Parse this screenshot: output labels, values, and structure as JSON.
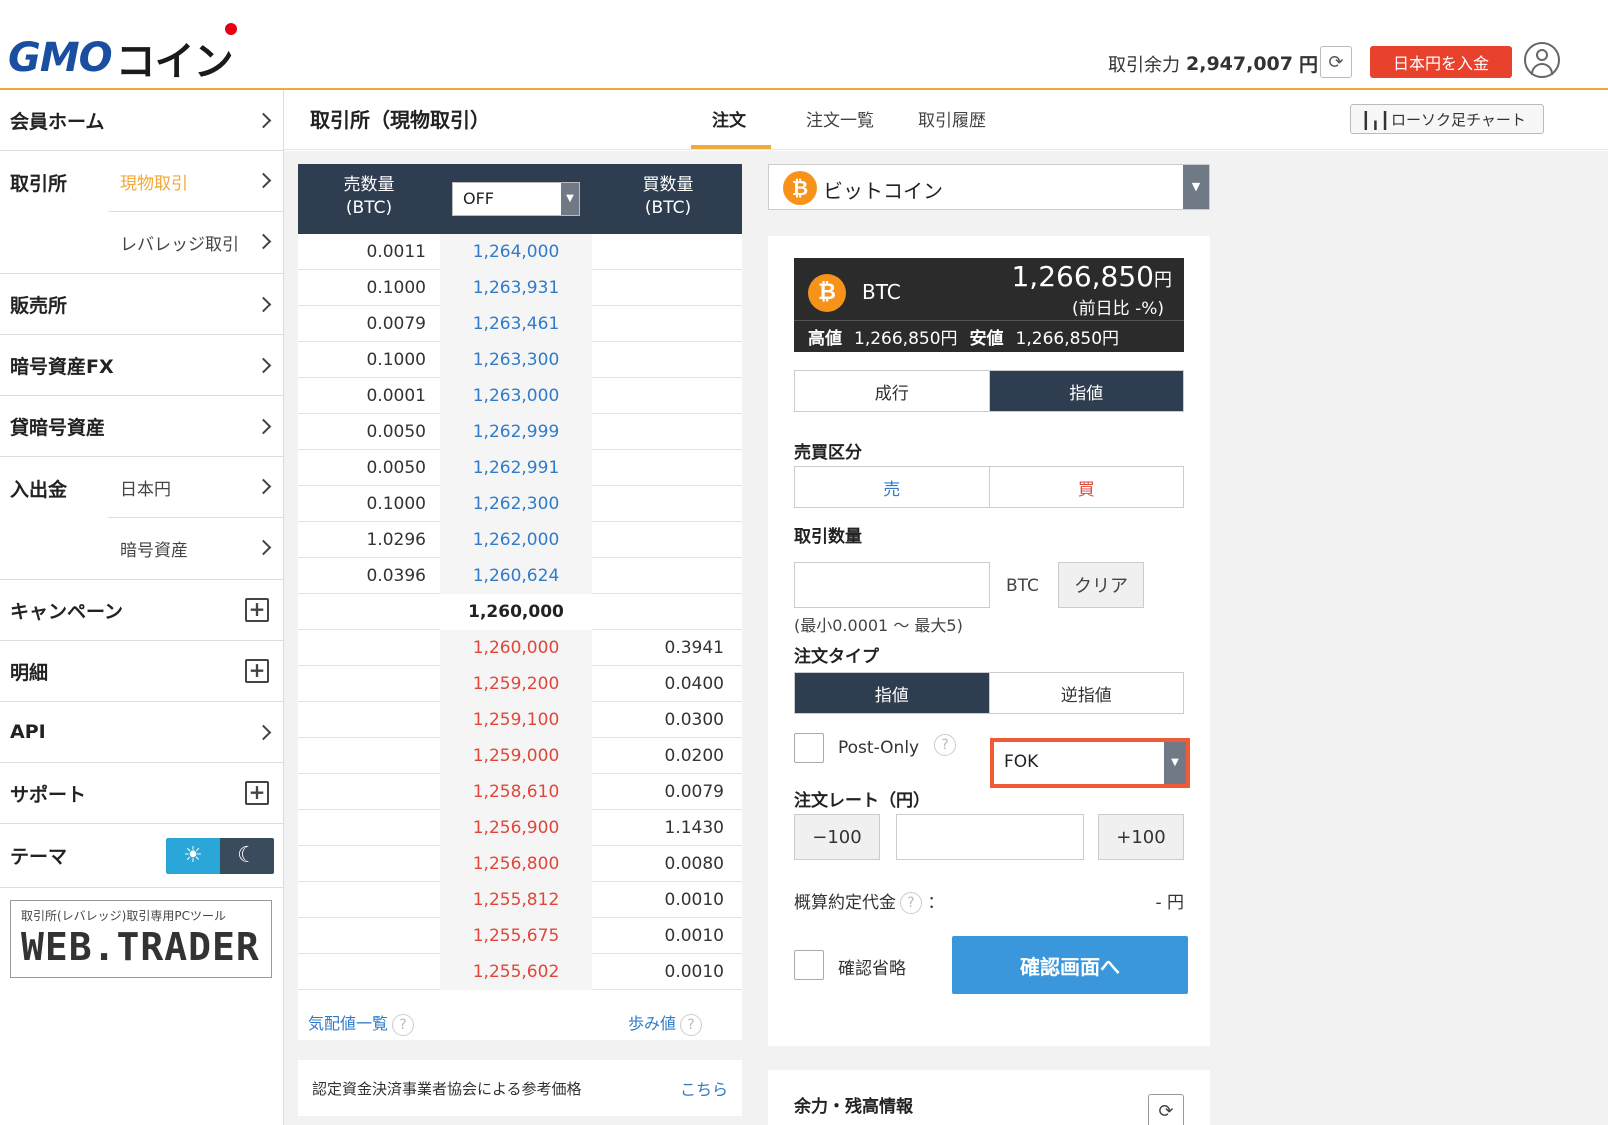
{
  "header": {
    "logo_main": "GMO",
    "logo_sub": "コイン",
    "balance_label": "取引余力",
    "balance_amount": "2,947,007",
    "balance_unit": "円",
    "deposit_button": "日本円を入金"
  },
  "sidebar": {
    "home": "会員ホーム",
    "exchange": "取引所",
    "exchange_spot": "現物取引",
    "exchange_leverage": "レバレッジ取引",
    "sales": "販売所",
    "fx": "暗号資産FX",
    "lending": "貸暗号資産",
    "deposit": "入出金",
    "deposit_jpy": "日本円",
    "deposit_crypto": "暗号資産",
    "campaign": "キャンペーン",
    "statement": "明細",
    "api": "API",
    "support": "サポート",
    "theme": "テーマ",
    "webtrader_caption": "取引所(レバレッジ)取引専用PCツール",
    "webtrader_name": "WEB.TRADER"
  },
  "subheader": {
    "title": "取引所（現物取引）",
    "tabs": [
      "注文",
      "注文一覧",
      "取引履歴"
    ],
    "candle_button": "ローソク足チャート"
  },
  "orderbook": {
    "sell_header_1": "売数量",
    "sell_header_2": "(BTC)",
    "buy_header_1": "買数量",
    "buy_header_2": "(BTC)",
    "group_select": "OFF",
    "asks": [
      {
        "qty": "0.0011",
        "price": "1,264,000"
      },
      {
        "qty": "0.1000",
        "price": "1,263,931"
      },
      {
        "qty": "0.0079",
        "price": "1,263,461"
      },
      {
        "qty": "0.1000",
        "price": "1,263,300"
      },
      {
        "qty": "0.0001",
        "price": "1,263,000"
      },
      {
        "qty": "0.0050",
        "price": "1,262,999"
      },
      {
        "qty": "0.0050",
        "price": "1,262,991"
      },
      {
        "qty": "0.1000",
        "price": "1,262,300"
      },
      {
        "qty": "1.0296",
        "price": "1,262,000"
      },
      {
        "qty": "0.0396",
        "price": "1,260,624"
      }
    ],
    "mid": "1,260,000",
    "bids": [
      {
        "price": "1,260,000",
        "qty": "0.3941"
      },
      {
        "price": "1,259,200",
        "qty": "0.0400"
      },
      {
        "price": "1,259,100",
        "qty": "0.0300"
      },
      {
        "price": "1,259,000",
        "qty": "0.0200"
      },
      {
        "price": "1,258,610",
        "qty": "0.0079"
      },
      {
        "price": "1,256,900",
        "qty": "1.1430"
      },
      {
        "price": "1,256,800",
        "qty": "0.0080"
      },
      {
        "price": "1,255,812",
        "qty": "0.0010"
      },
      {
        "price": "1,255,675",
        "qty": "0.0010"
      },
      {
        "price": "1,255,602",
        "qty": "0.0010"
      }
    ],
    "footer_left": "気配値一覧",
    "footer_right": "歩み値",
    "help_glyph": "?"
  },
  "reference": {
    "label": "認定資金決済事業者協会による参考価格",
    "link": "こちら"
  },
  "coin_select": {
    "name": "ビットコイン",
    "icon_glyph": "₿"
  },
  "ticker": {
    "symbol": "BTC",
    "price": "1,266,850",
    "price_unit": "円",
    "change": "(前日比 -%)",
    "high_label": "高値",
    "high": "1,266,850円",
    "low_label": "安値",
    "low": "1,266,850円"
  },
  "order": {
    "exec_market": "成行",
    "exec_limit": "指値",
    "side_label": "売買区分",
    "sell": "売",
    "buy": "買",
    "qty_label": "取引数量",
    "qty_value": "",
    "qty_unit": "BTC",
    "clear": "クリア",
    "qty_hint": "(最小0.0001 〜 最大5)",
    "type_label": "注文タイプ",
    "type_limit": "指値",
    "type_stop": "逆指値",
    "post_only": "Post-Only",
    "tif": "FOK",
    "rate_label": "注文レート（円）",
    "minus": "−100",
    "plus": "+100",
    "rate_value": "",
    "estimate_label": "概算約定代金",
    "estimate_colon": "：",
    "estimate_value": "- 円",
    "skip_confirm": "確認省略",
    "confirm_button": "確認画面へ"
  },
  "balance_panel": {
    "title": "余力・残高情報"
  },
  "colors": {
    "accent": "#f0a93a",
    "navy": "#2e3d50",
    "ask": "#2f7bc9",
    "bid": "#e0463a",
    "deposit": "#e8412c",
    "confirm": "#3a97db",
    "highlight": "#f05a34"
  }
}
